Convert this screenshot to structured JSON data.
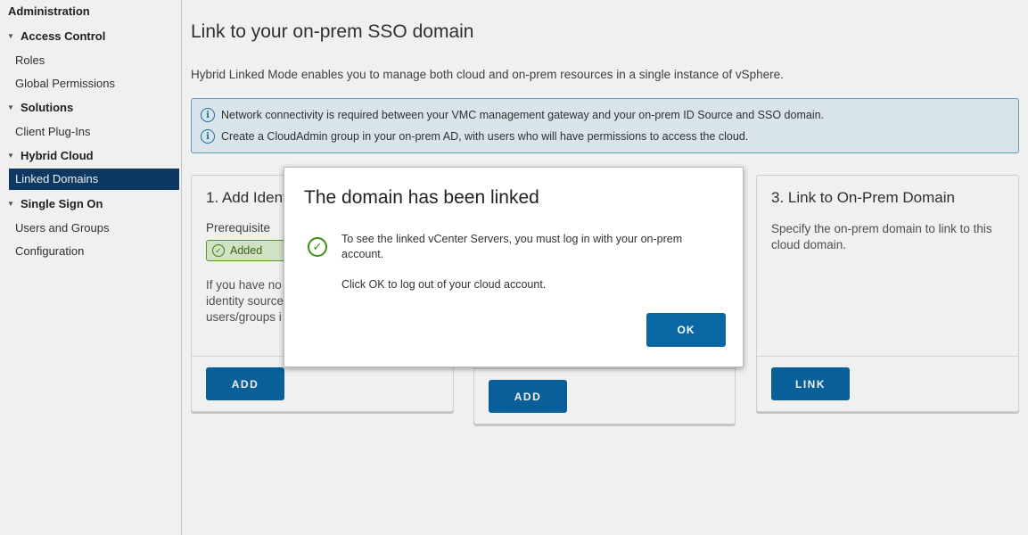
{
  "sidebar": {
    "title": "Administration",
    "groups": [
      {
        "label": "Access Control",
        "items": [
          "Roles",
          "Global Permissions"
        ]
      },
      {
        "label": "Solutions",
        "items": [
          "Client Plug-Ins"
        ]
      },
      {
        "label": "Hybrid Cloud",
        "items": [
          "Linked Domains"
        ]
      },
      {
        "label": "Single Sign On",
        "items": [
          "Users and Groups",
          "Configuration"
        ]
      }
    ],
    "active_item": "Linked Domains"
  },
  "main": {
    "title": "Link to your on-prem SSO domain",
    "description": "Hybrid Linked Mode enables you to manage both cloud and on-prem resources in a single instance of vSphere.",
    "info": [
      "Network connectivity is required between your VMC management gateway and your on-prem ID Source and SSO domain.",
      "Create a CloudAdmin group in your on-prem AD, with users who will have permissions to access the cloud."
    ],
    "cards": [
      {
        "title": "1. Add Ident",
        "prereq_label": "Prerequisite",
        "badge": "Added",
        "text": [
          "If you have no",
          "identity source",
          "users/groups i"
        ],
        "button": "ADD"
      },
      {
        "button": "ADD"
      },
      {
        "title": "3. Link to On-Prem Domain",
        "text": [
          "Specify the on-prem domain to link to this",
          "cloud domain."
        ],
        "button": "LINK"
      }
    ]
  },
  "modal": {
    "title": "The domain has been linked",
    "message_line1": "To see the linked vCenter Servers, you must log in with your on-prem",
    "message_line2": "account.",
    "message2": "Click OK to log out of your cloud account.",
    "ok_label": "OK"
  },
  "icons": {
    "info": "info-icon",
    "check": "check-circle-icon",
    "caret": "caret-down-icon"
  },
  "colors": {
    "sidebar_active": "#0e3c68",
    "primary_button": "#0a67a3",
    "info_border": "#65a7c6",
    "info_bg": "#e6f3f9",
    "success": "#3e8e12"
  }
}
